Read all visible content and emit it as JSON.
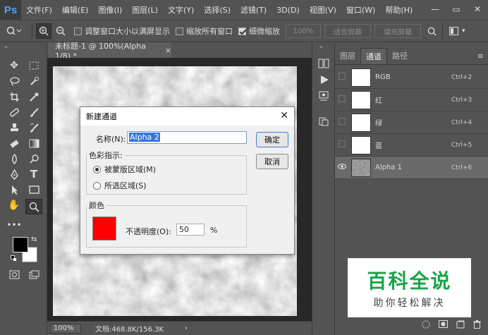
{
  "app": {
    "logo": "Ps"
  },
  "menubar": {
    "items": [
      "文件(F)",
      "编辑(E)",
      "图像(I)",
      "图层(L)",
      "文字(Y)",
      "选择(S)",
      "滤镜(T)",
      "3D(D)",
      "视图(V)",
      "窗口(W)",
      "帮助(H)"
    ]
  },
  "window_controls": {
    "minimize": "—",
    "maximize": "▭",
    "close": "✕"
  },
  "options_bar": {
    "resize_windows_label": "调整窗口大小以满屏显示",
    "resize_windows_checked": false,
    "zoom_all_label": "缩放所有窗口",
    "zoom_all_checked": false,
    "scrubby_zoom_label": "细微缩放",
    "scrubby_zoom_checked": true,
    "zoom_100_label": "100%",
    "fit_screen_label": "适合屏幕",
    "fill_screen_label": "填充屏幕"
  },
  "document": {
    "tab_title": "未标题-1 @ 100%(Alpha 1/8) *",
    "tab_close": "×",
    "status_zoom": "100%",
    "status_doc": "文档:468.8K/156.3K",
    "status_arrow": "›"
  },
  "panel": {
    "tabs": [
      "图层",
      "通道",
      "路径"
    ],
    "active_tab": "通道",
    "channels": [
      {
        "name": "RGB",
        "shortcut": "Ctrl+2",
        "visible": false,
        "selected": false
      },
      {
        "name": "红",
        "shortcut": "Ctrl+3",
        "visible": false,
        "selected": false
      },
      {
        "name": "绿",
        "shortcut": "Ctrl+4",
        "visible": false,
        "selected": false
      },
      {
        "name": "蓝",
        "shortcut": "Ctrl+5",
        "visible": false,
        "selected": false
      },
      {
        "name": "Alpha 1",
        "shortcut": "Ctrl+6",
        "visible": true,
        "selected": true
      }
    ]
  },
  "dialog": {
    "title": "新建通道",
    "close": "✕",
    "name_label": "名称(N):",
    "name_value": "Alpha 2",
    "ok_label": "确定",
    "cancel_label": "取消",
    "color_indicates_label": "色彩指示:",
    "masked_label": "被蒙版区域(M)",
    "masked_selected": true,
    "selected_label": "所选区域(S)",
    "color_group_label": "颜色",
    "color_swatch": "#ff0000",
    "opacity_label": "不透明度(O):",
    "opacity_value": "50",
    "opacity_unit": "%"
  },
  "watermark": {
    "line1": "百科全说",
    "line2": "助你轻松解决"
  },
  "colors": {
    "foreground": "#000000",
    "background": "#ffffff",
    "accent_blue": "#4fa3f7",
    "watermark_green": "#1aa34a"
  }
}
